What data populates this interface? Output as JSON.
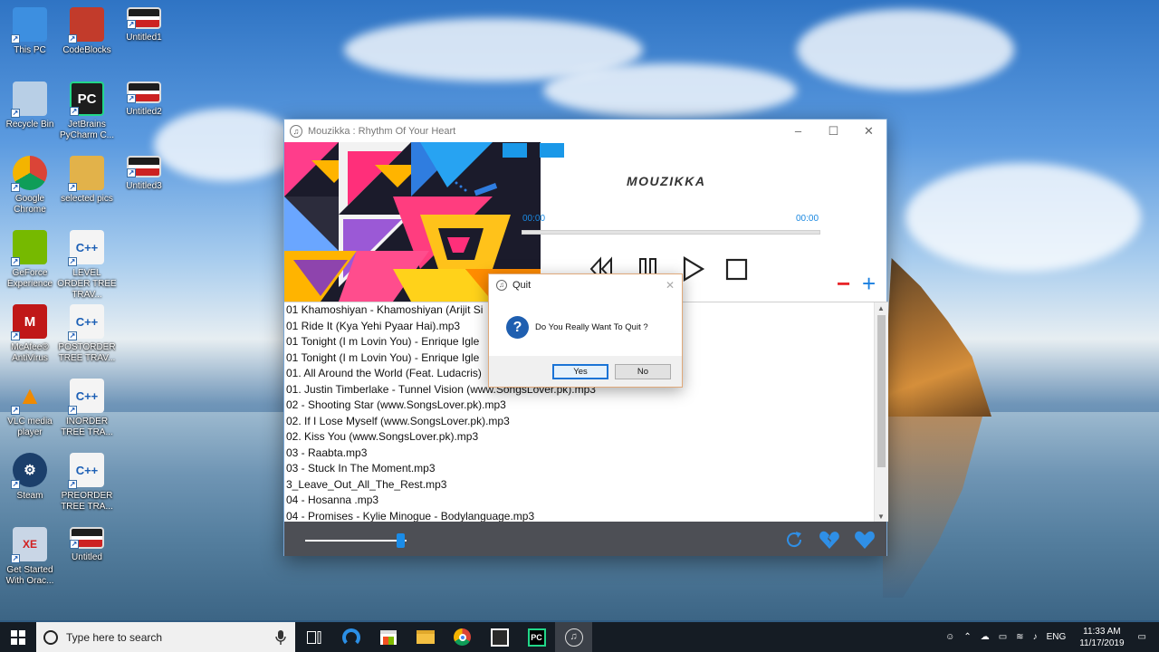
{
  "desktop": {
    "icons": [
      {
        "label": "This PC",
        "icon": "this-pc-icon",
        "color": "#3d8fe0"
      },
      {
        "label": "CodeBlocks",
        "icon": "codeblocks-icon",
        "color": "#c23b2b"
      },
      {
        "label": "Untitled1",
        "icon": "image-file-icon",
        "color": "#f2f2f2"
      },
      {
        "label": "Recycle Bin",
        "icon": "recycle-bin-icon",
        "color": "#b8cfe6"
      },
      {
        "label": "JetBrains PyCharm C...",
        "icon": "pycharm-icon",
        "color": "#1d1d1d"
      },
      {
        "label": "Untitled2",
        "icon": "image-file-icon",
        "color": "#f2f2f2"
      },
      {
        "label": "Google Chrome",
        "icon": "chrome-icon",
        "color": "#db4437"
      },
      {
        "label": "selected pics",
        "icon": "folder-icon",
        "color": "#e2b24a"
      },
      {
        "label": "Untitled3",
        "icon": "image-file-icon",
        "color": "#f2f2f2"
      },
      {
        "label": "GeForce Experience",
        "icon": "geforce-icon",
        "color": "#76b900"
      },
      {
        "label": "LEVEL ORDER TREE TRAV...",
        "icon": "cpp-file-icon",
        "color": "#f4f4f4"
      },
      {
        "label": "McAfee® AntiVirus",
        "icon": "mcafee-icon",
        "color": "#c01818"
      },
      {
        "label": "POSTORDER TREE TRAV...",
        "icon": "cpp-file-icon",
        "color": "#f4f4f4"
      },
      {
        "label": "VLC media player",
        "icon": "vlc-icon",
        "color": "#f08a00"
      },
      {
        "label": "INORDER TREE TRA...",
        "icon": "cpp-file-icon",
        "color": "#f4f4f4"
      },
      {
        "label": "Steam",
        "icon": "steam-icon",
        "color": "#1b3f6b"
      },
      {
        "label": "PREORDER TREE TRA...",
        "icon": "cpp-file-icon",
        "color": "#f4f4f4"
      },
      {
        "label": "Get Started With Orac...",
        "icon": "oracle-xe-icon",
        "color": "#c9d6e6"
      },
      {
        "label": "Untitled",
        "icon": "image-file-icon",
        "color": "#f2f2f2"
      }
    ]
  },
  "window": {
    "title": "Mouzikka : Rhythm Of Your Heart",
    "app_name": "MOUZIKKA",
    "time_elapsed": "00:00",
    "time_total": "00:00",
    "progress_fraction": 0,
    "volume_fraction": 0.9,
    "minus_symbol": "−",
    "plus_symbol": "+",
    "accent_color": "#1a98e8",
    "tracks": [
      "01 Khamoshiyan - Khamoshiyan (Arijit Si",
      "01 Ride It (Kya Yehi Pyaar Hai).mp3",
      "01 Tonight (I m Lovin  You) - Enrique Igle",
      "01 Tonight (I m Lovin  You) - Enrique Igle",
      "01. All Around the World (Feat. Ludacris)",
      "01. Justin Timberlake - Tunnel Vision (www.SongsLover.pk).mp3",
      "02 - Shooting Star (www.SongsLover.pk).mp3",
      "02. If I Lose Myself (www.SongsLover.pk).mp3",
      "02. Kiss You (www.SongsLover.pk).mp3",
      "03 - Raabta.mp3",
      "03 - Stuck In The Moment.mp3",
      "3_Leave_Out_All_The_Rest.mp3",
      "04 - Hosanna .mp3",
      "04 - Promises -  Kylie Minogue - Bodylanguage.mp3"
    ]
  },
  "dialog": {
    "title": "Quit",
    "message": "Do You Really Want To Quit  ?",
    "yes_label": "Yes",
    "no_label": "No"
  },
  "taskbar": {
    "search_placeholder": "Type here to search",
    "language": "ENG",
    "time": "11:33 AM",
    "date": "11/17/2019"
  }
}
